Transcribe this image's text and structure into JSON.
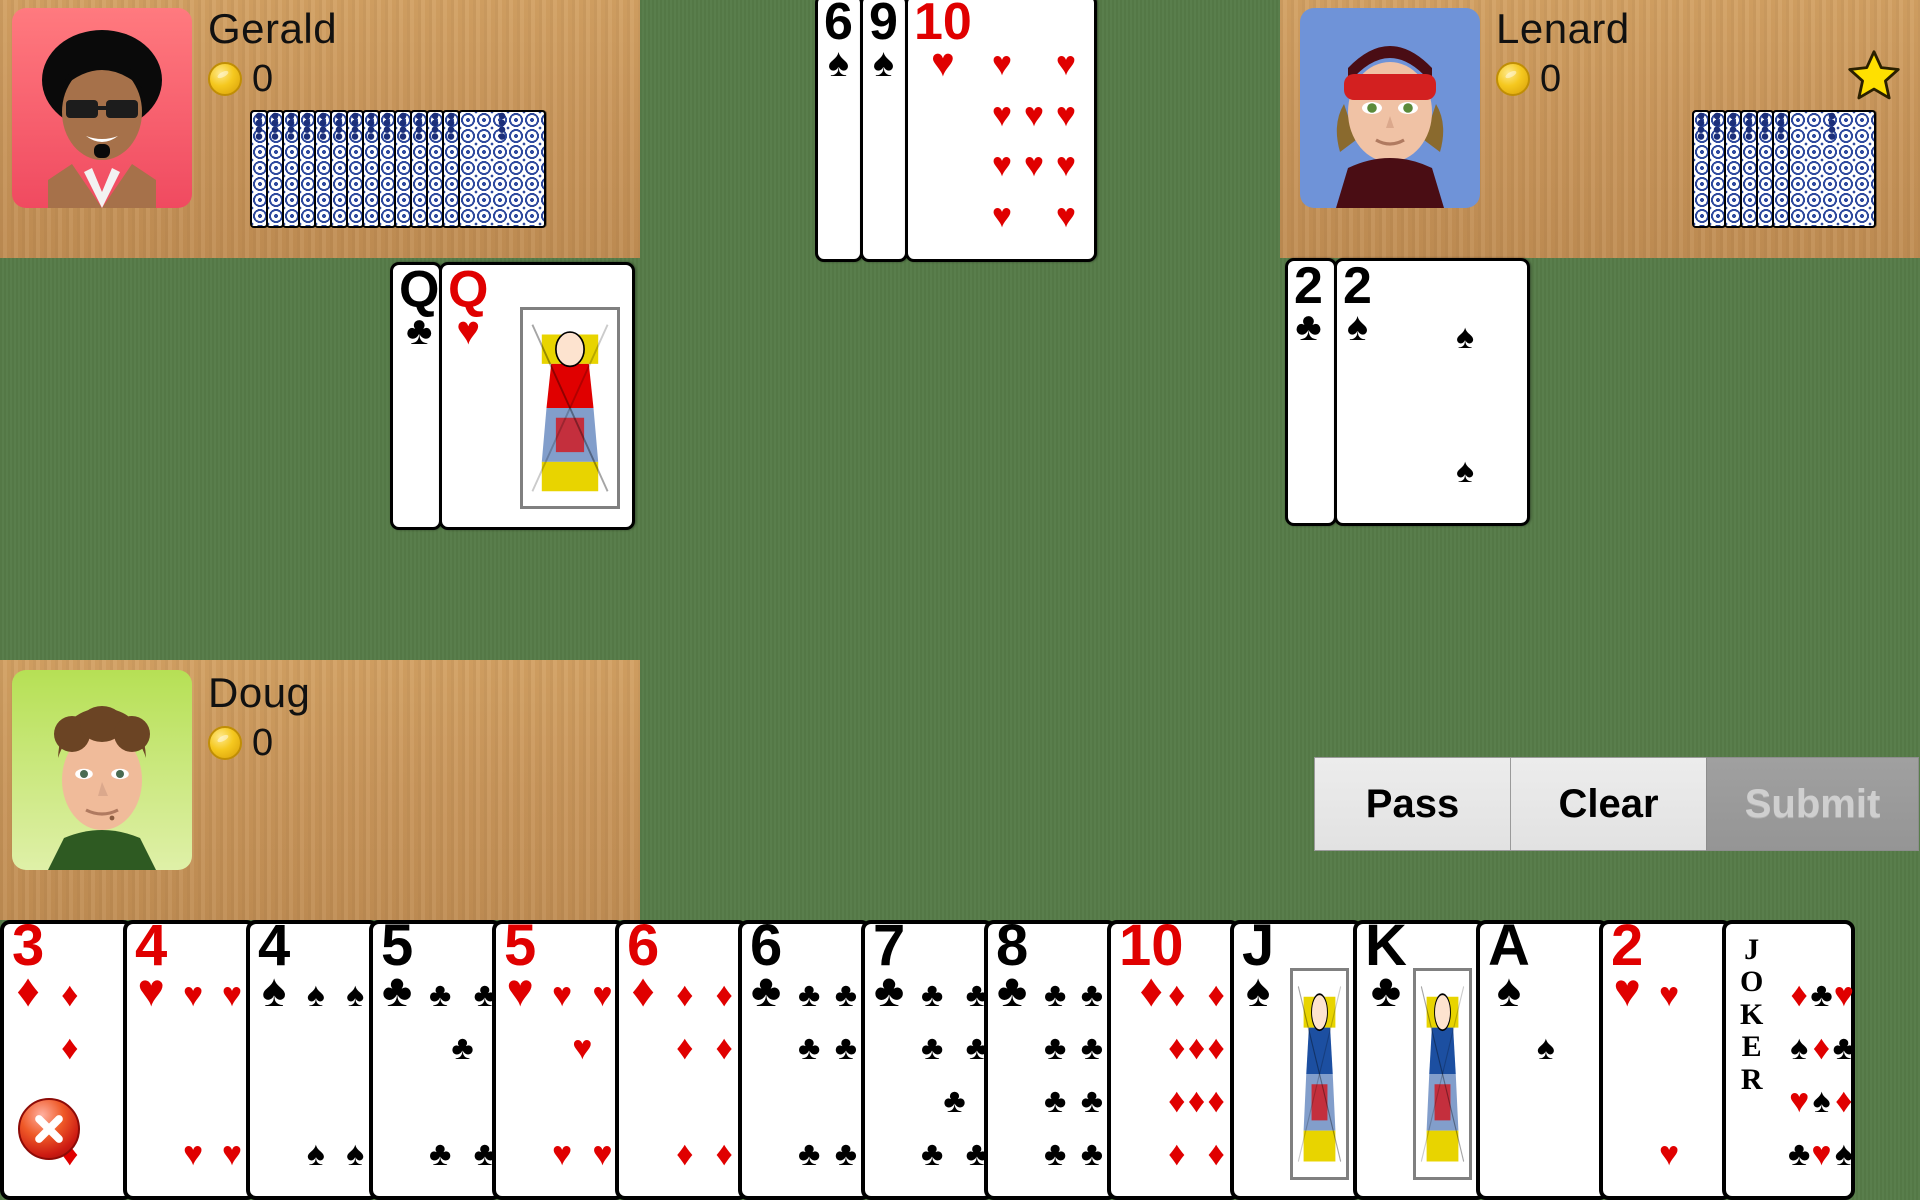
{
  "theme": {
    "felt_color": "#567b48",
    "wood_color": "#c8955a",
    "red_suit_color": "#e00000",
    "black_suit_color": "#000000",
    "star_color": "#ffe000",
    "coin_color": "#f5c81f"
  },
  "players": [
    {
      "name": "Gerald",
      "coins": "0",
      "card_count": 14,
      "has_star": false,
      "avatar": "gerald-avatar",
      "position": "top-left"
    },
    {
      "name": "Lenard",
      "coins": "0",
      "card_count": 7,
      "has_star": true,
      "avatar": "lenard-avatar",
      "position": "top-right"
    },
    {
      "name": "Doug",
      "coins": "0",
      "card_count": 0,
      "has_star": false,
      "avatar": "doug-avatar",
      "position": "bottom-left"
    }
  ],
  "star_icon": "star-icon",
  "coin_icon": "coin-icon",
  "played_stacks": [
    {
      "id": "center-stack",
      "cards": [
        {
          "rank": "6",
          "suit": "♠",
          "color": "black",
          "face": false,
          "pips": 0
        },
        {
          "rank": "9",
          "suit": "♠",
          "color": "black",
          "face": false,
          "pips": 0
        },
        {
          "rank": "10",
          "suit": "♥",
          "color": "red",
          "face": false,
          "pips": 10
        }
      ]
    },
    {
      "id": "queens-stack",
      "cards": [
        {
          "rank": "Q",
          "suit": "♣",
          "color": "black",
          "face": false,
          "pips": 0
        },
        {
          "rank": "Q",
          "suit": "♥",
          "color": "red",
          "face": true,
          "pips": 0
        }
      ]
    },
    {
      "id": "twos-stack",
      "cards": [
        {
          "rank": "2",
          "suit": "♣",
          "color": "black",
          "face": false,
          "pips": 0
        },
        {
          "rank": "2",
          "suit": "♠",
          "color": "black",
          "face": false,
          "pips": 2
        }
      ]
    }
  ],
  "hand": {
    "cards": [
      {
        "rank": "3",
        "suit": "♦",
        "color": "red",
        "pips": 3,
        "face": false,
        "joker": false
      },
      {
        "rank": "4",
        "suit": "♥",
        "color": "red",
        "pips": 4,
        "face": false,
        "joker": false
      },
      {
        "rank": "4",
        "suit": "♠",
        "color": "black",
        "pips": 4,
        "face": false,
        "joker": false
      },
      {
        "rank": "5",
        "suit": "♣",
        "color": "black",
        "pips": 5,
        "face": false,
        "joker": false
      },
      {
        "rank": "5",
        "suit": "♥",
        "color": "red",
        "pips": 5,
        "face": false,
        "joker": false
      },
      {
        "rank": "6",
        "suit": "♦",
        "color": "red",
        "pips": 6,
        "face": false,
        "joker": false
      },
      {
        "rank": "6",
        "suit": "♣",
        "color": "black",
        "pips": 6,
        "face": false,
        "joker": false
      },
      {
        "rank": "7",
        "suit": "♣",
        "color": "black",
        "pips": 7,
        "face": false,
        "joker": false
      },
      {
        "rank": "8",
        "suit": "♣",
        "color": "black",
        "pips": 8,
        "face": false,
        "joker": false
      },
      {
        "rank": "10",
        "suit": "♦",
        "color": "red",
        "pips": 10,
        "face": false,
        "joker": false
      },
      {
        "rank": "J",
        "suit": "♠",
        "color": "black",
        "pips": 0,
        "face": true,
        "joker": false
      },
      {
        "rank": "K",
        "suit": "♣",
        "color": "black",
        "pips": 0,
        "face": true,
        "joker": false
      },
      {
        "rank": "A",
        "suit": "♠",
        "color": "black",
        "pips": 1,
        "face": false,
        "joker": false
      },
      {
        "rank": "2",
        "suit": "♥",
        "color": "red",
        "pips": 2,
        "face": false,
        "joker": false
      },
      {
        "rank": "JOKER",
        "suit": "",
        "color": "black",
        "pips": 0,
        "face": false,
        "joker": true
      }
    ]
  },
  "buttons": {
    "pass": {
      "label": "Pass",
      "enabled": true
    },
    "clear": {
      "label": "Clear",
      "enabled": true
    },
    "submit": {
      "label": "Submit",
      "enabled": false
    }
  },
  "close_button": {
    "icon": "close-x-icon"
  }
}
